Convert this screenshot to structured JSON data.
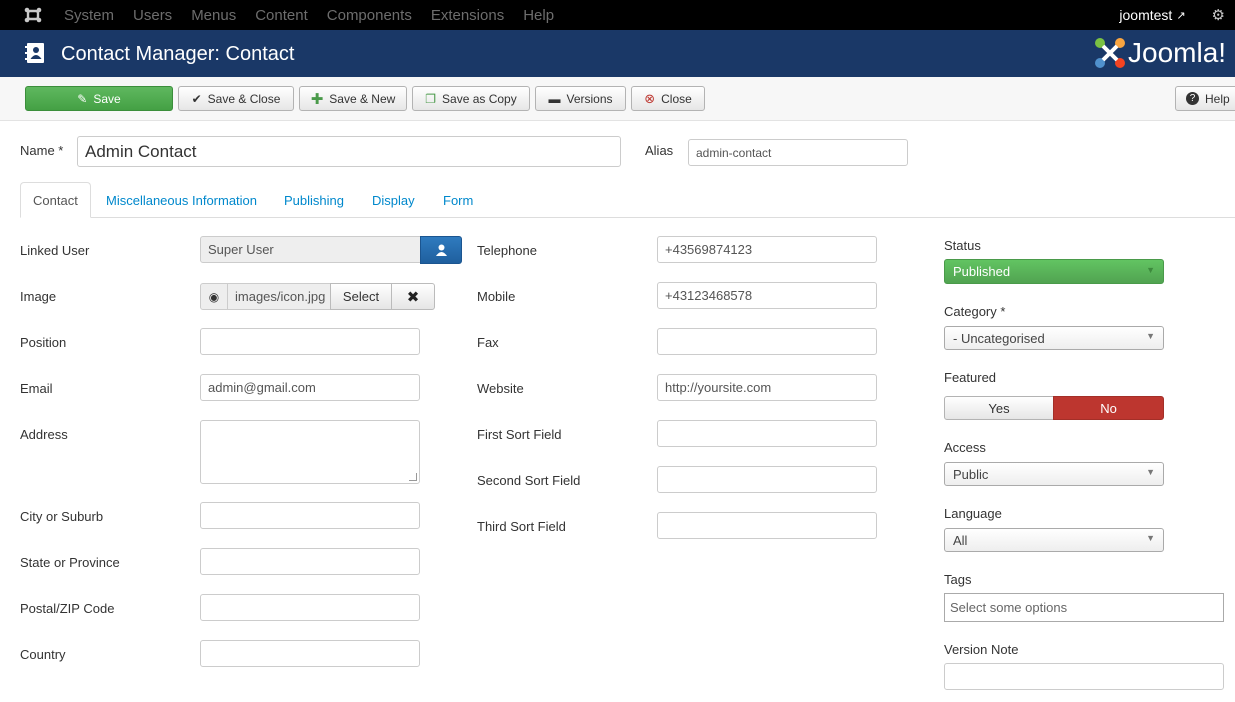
{
  "topnav": {
    "menu": [
      "System",
      "Users",
      "Menus",
      "Content",
      "Components",
      "Extensions",
      "Help"
    ],
    "user": "joomtest",
    "icons": [
      "joomla-icon",
      "external-link-icon",
      "gear-icon"
    ]
  },
  "header": {
    "title": "Contact Manager: Contact",
    "brand": "Joomla!"
  },
  "toolbar": {
    "save": "Save",
    "save_close": "Save & Close",
    "save_new": "Save & New",
    "save_copy": "Save as Copy",
    "versions": "Versions",
    "close": "Close",
    "help": "Help"
  },
  "form": {
    "name_label": "Name *",
    "name_value": "Admin Contact",
    "alias_label": "Alias",
    "alias_value": "admin-contact"
  },
  "tabs": [
    "Contact",
    "Miscellaneous Information",
    "Publishing",
    "Display",
    "Form"
  ],
  "contact": {
    "linked_user_label": "Linked User",
    "linked_user_value": "Super User",
    "image_label": "Image",
    "image_value": "images/icon.jpg",
    "image_select": "Select",
    "position_label": "Position",
    "email_label": "Email",
    "email_value": "admin@gmail.com",
    "address_label": "Address",
    "city_label": "City or Suburb",
    "state_label": "State or Province",
    "postal_label": "Postal/ZIP Code",
    "country_label": "Country",
    "telephone_label": "Telephone",
    "telephone_value": "+43569874123",
    "mobile_label": "Mobile",
    "mobile_value": "+43123468578",
    "fax_label": "Fax",
    "website_label": "Website",
    "website_value": "http://yoursite.com",
    "sort1_label": "First Sort Field",
    "sort2_label": "Second Sort Field",
    "sort3_label": "Third Sort Field"
  },
  "sidebar": {
    "status_label": "Status",
    "status_value": "Published",
    "category_label": "Category *",
    "category_value": "- Uncategorised",
    "featured_label": "Featured",
    "featured_yes": "Yes",
    "featured_no": "No",
    "access_label": "Access",
    "access_value": "Public",
    "language_label": "Language",
    "language_value": "All",
    "tags_label": "Tags",
    "tags_placeholder": "Select some options",
    "version_note_label": "Version Note"
  },
  "colors": {
    "navbar": "#000000",
    "header": "#1a3867",
    "save_green": "#51a351",
    "link_blue": "#0088cc",
    "no_red": "#bd362f",
    "user_button_blue": "#2a6fb0"
  }
}
